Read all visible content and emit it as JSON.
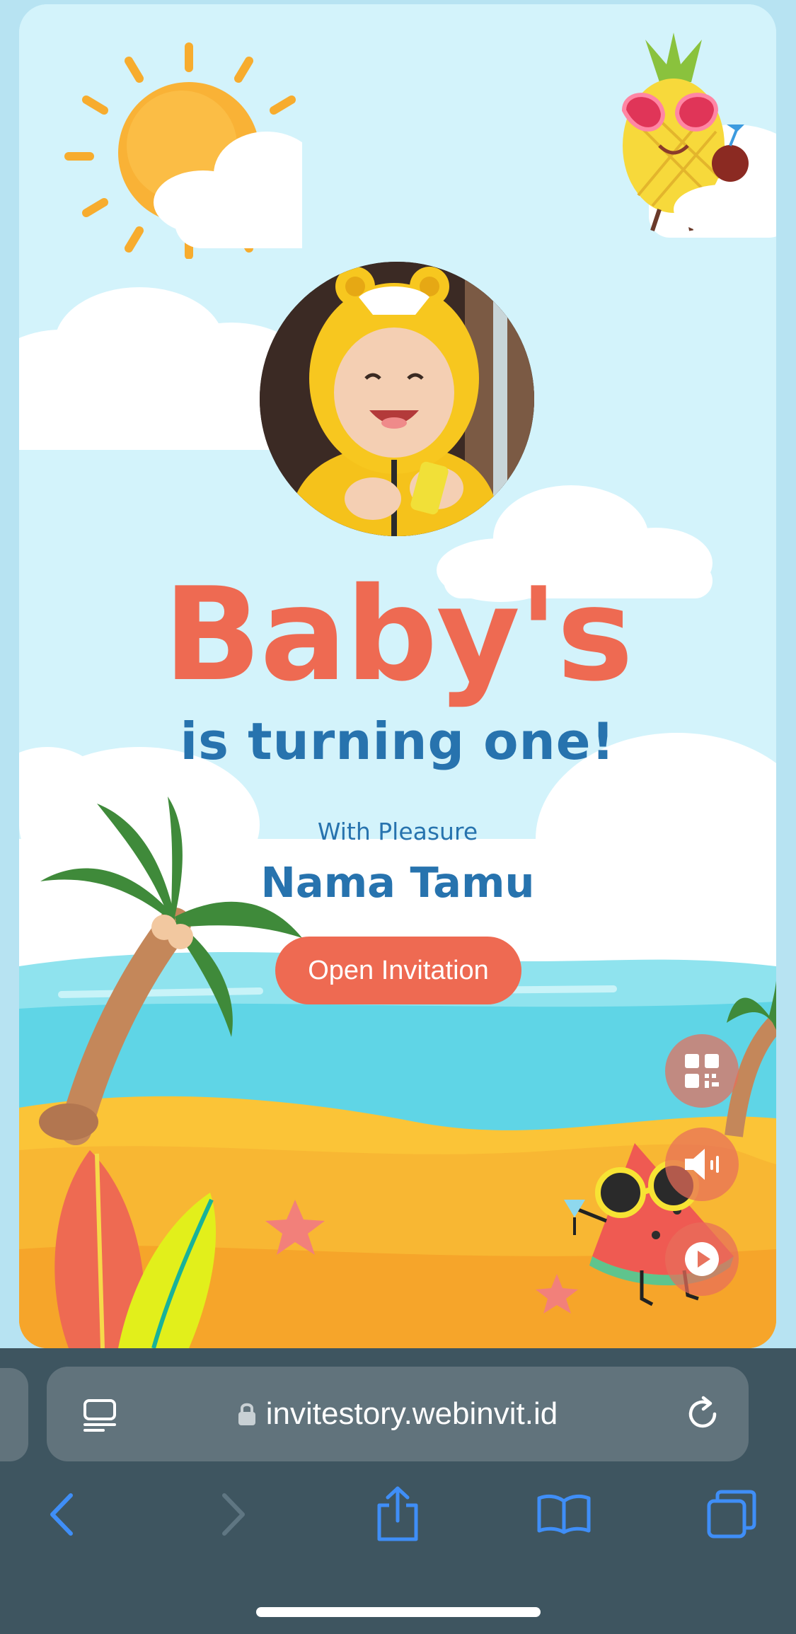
{
  "invitation": {
    "title": "Baby's",
    "subtitle": "is turning one!",
    "greeting": "With Pleasure",
    "guest_name": "Nama Tamu",
    "open_button_label": "Open Invitation"
  },
  "floating_actions": [
    {
      "name": "qr-code",
      "icon": "qr-code-icon"
    },
    {
      "name": "audio",
      "icon": "speaker-icon"
    },
    {
      "name": "autoplay",
      "icon": "play-icon"
    }
  ],
  "browser": {
    "url": "invitestory.webinvit.id",
    "toolbar": {
      "back": "back-icon",
      "forward": "forward-icon",
      "share": "share-icon",
      "bookmarks": "book-icon",
      "tabs": "tabs-icon"
    }
  },
  "colors": {
    "sky": "#d3f3fb",
    "title": "#ee6a52",
    "text_blue": "#2773ae",
    "button": "#ee6a52",
    "sea": "#5fd5e6",
    "sand": "#f8b733",
    "chrome": "#3e5560",
    "toolbar_icon": "#3f8ef7"
  }
}
